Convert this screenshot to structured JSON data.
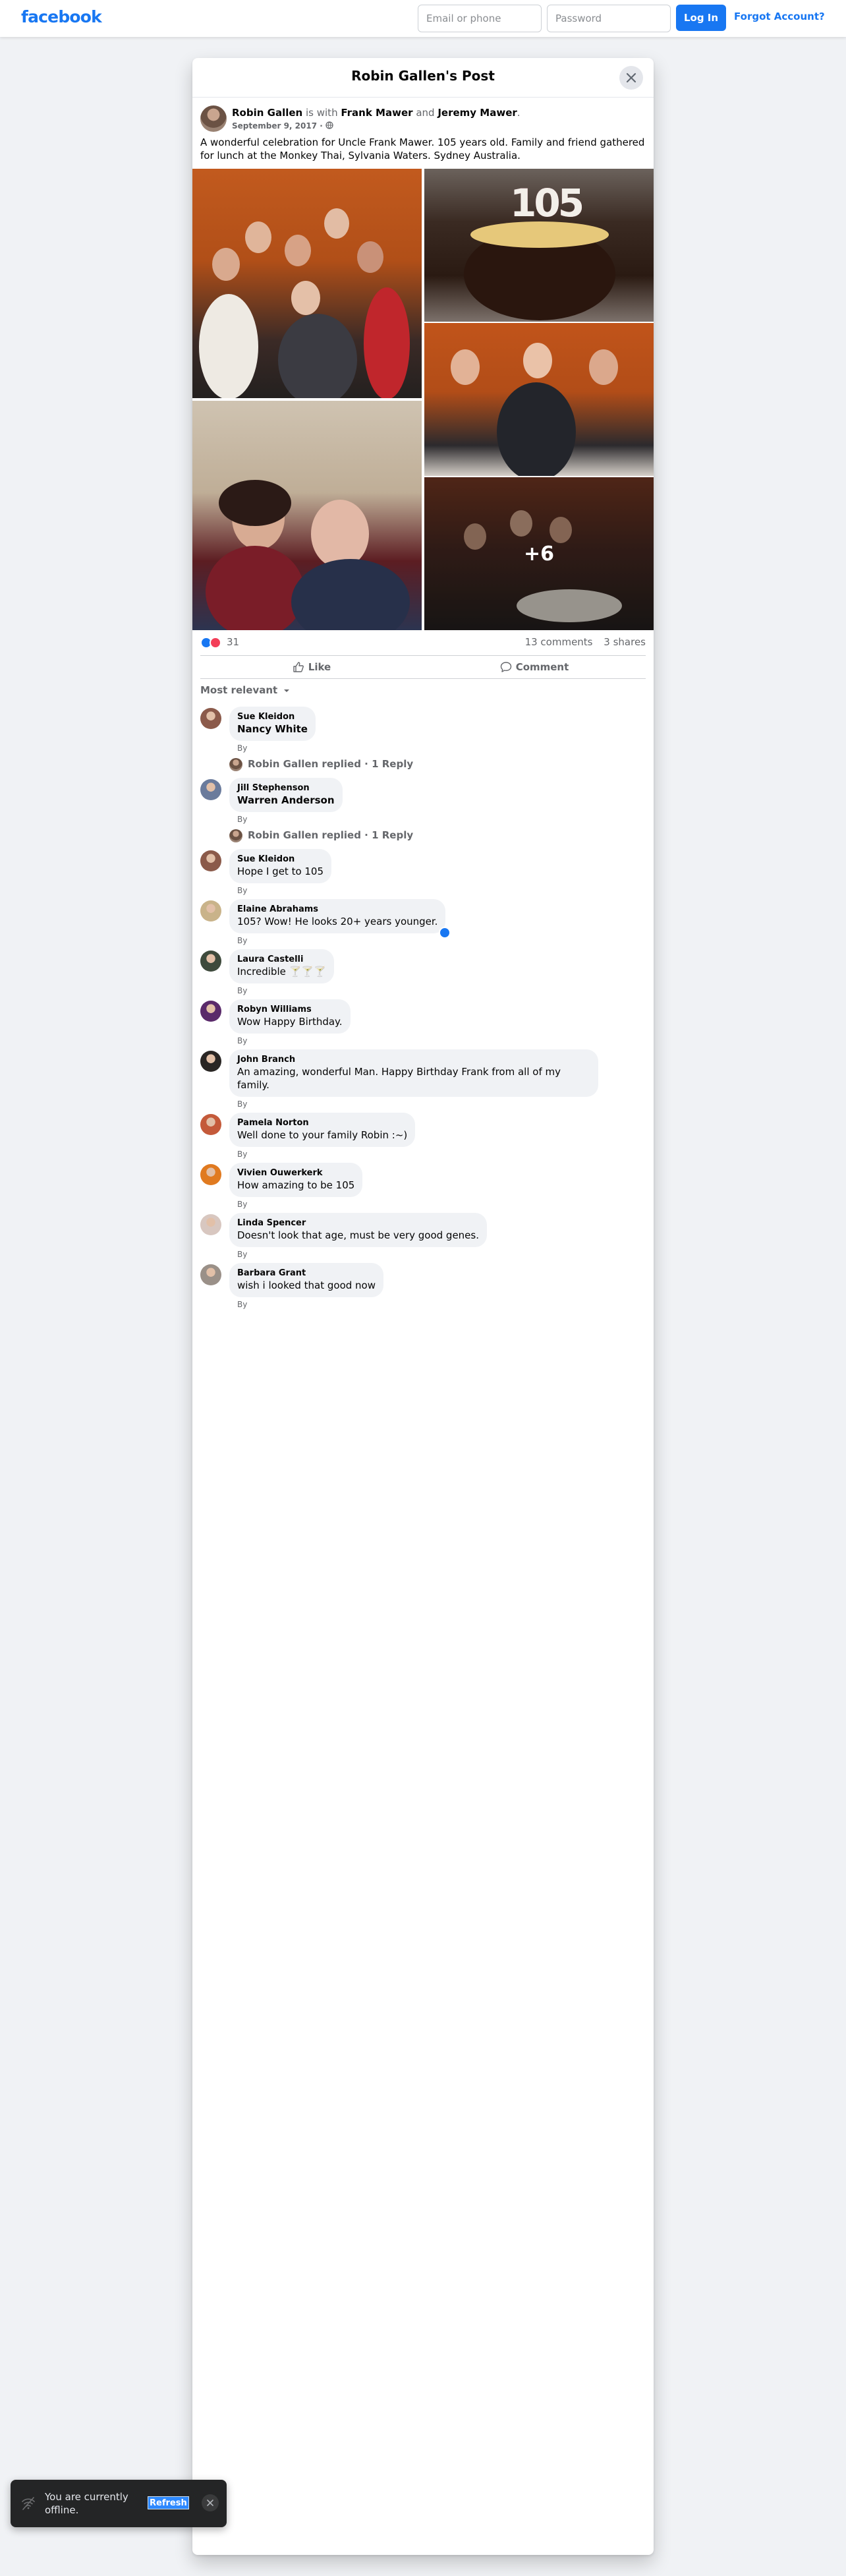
{
  "header": {
    "logo": "facebook",
    "email_placeholder": "Email or phone",
    "password_placeholder": "Password",
    "login_label": "Log In",
    "forgot_label": "Forgot Account?"
  },
  "dialog": {
    "title": "Robin Gallen's Post"
  },
  "post": {
    "author": "Robin Gallen",
    "with_text": "is with",
    "tag1": "Frank Mawer",
    "and_text": "and",
    "tag2": "Jeremy Mawer",
    "date": "September 9, 2017 · ",
    "text": "A wonderful celebration for Uncle Frank Mawer. 105 years old. Family and friend gathered for lunch at the Monkey Thai, Sylvania Waters. Sydney Australia.",
    "cake_number": "105",
    "more_photos": "+6",
    "reaction_count": "31",
    "comments_count": "13 comments",
    "shares_count": "3 shares",
    "like_label": "Like",
    "comment_label": "Comment",
    "sort_label": "Most relevant"
  },
  "comments": [
    {
      "name": "Sue Kleidon",
      "text": "Nancy White",
      "meta": "By",
      "reply": "Robin Gallen replied · 1 Reply",
      "color": "#8b5a4a"
    },
    {
      "name": "Jill Stephenson",
      "text": "Warren Anderson",
      "meta": "By",
      "reply": "Robin Gallen replied · 1 Reply",
      "color": "#6a7b9c"
    },
    {
      "name": "Sue Kleidon",
      "text": "Hope I get to 105",
      "meta": "By",
      "color": "#8b5a4a"
    },
    {
      "name": "Elaine Abrahams",
      "text": "105? Wow! He looks 20+ years younger.",
      "meta": "By",
      "color": "#c9b38a"
    },
    {
      "name": "Laura Castelli",
      "text": "Incredible 🍸🍸🍸",
      "meta": "By",
      "color": "#3e4a3c"
    },
    {
      "name": "Robyn Williams",
      "text": "Wow Happy Birthday.",
      "meta": "By",
      "color": "#5a2a6a"
    },
    {
      "name": "John Branch",
      "text": "An amazing, wonderful Man. Happy Birthday Frank from all of my family.",
      "meta": "By",
      "color": "#2a2624"
    },
    {
      "name": "Pamela Norton",
      "text": "Well done to your family Robin :~)",
      "meta": "By",
      "color": "#c45a3a"
    },
    {
      "name": "Vivien Ouwerkerk",
      "text": "How amazing to be 105",
      "meta": "By",
      "color": "#e07a20"
    },
    {
      "name": "Linda Spencer",
      "text": "Doesn't look that age, must be very good genes.",
      "meta": "By",
      "color": "#d8c7c0"
    },
    {
      "name": "Barbara Grant",
      "text": "wish i looked that good now",
      "meta": "By",
      "color": "#9a9088"
    }
  ],
  "toast": {
    "text": "You are currently offline.",
    "refresh_label": "Refresh"
  },
  "colors": {
    "brand": "#1877f2",
    "background": "#f0f2f5",
    "toast_bg": "#242526"
  },
  "icons": [
    "close-icon",
    "globe-icon",
    "like-icon",
    "comment-icon",
    "chevron-down-icon",
    "wifi-off-icon"
  ]
}
